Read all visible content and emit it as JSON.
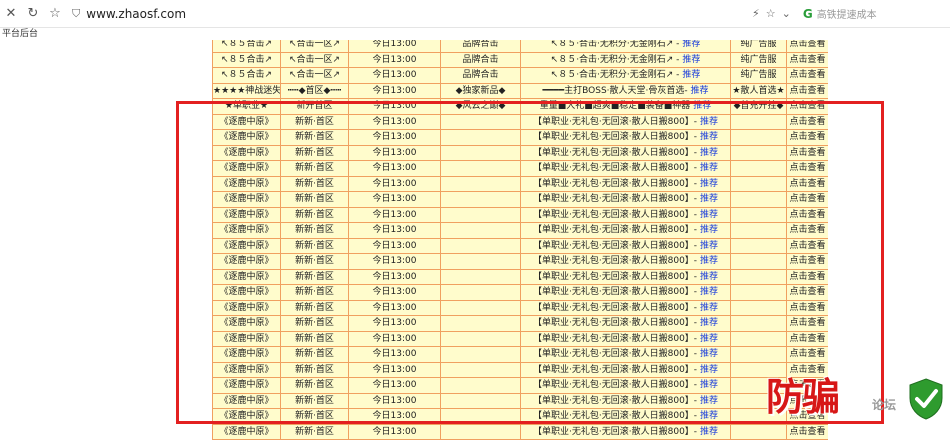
{
  "browser": {
    "url": "www.zhaosf.com",
    "search_placeholder": "高铁提速成本",
    "bookmark": "平台后台",
    "icons": [
      "close-icon",
      "reload-icon",
      "star-icon",
      "shield-icon",
      "lightning-icon",
      "star-outline-icon",
      "chevron-down-icon",
      "search-engine-icon"
    ]
  },
  "colors": {
    "grid_bg": "#fffccc",
    "grid_border": "#f0a060",
    "recommend": "#1a3cdb",
    "highlight_box": "#e32020"
  },
  "rows": [
    {
      "server": "↖８５合击↗",
      "region": "↖合击一区↗",
      "time": "今日13:00",
      "type": "品牌合击",
      "intro": "↖８５·合击·无积分·无金刚石↗ -",
      "rec": "推荐",
      "client": "纯广告服",
      "action": "点击查看"
    },
    {
      "server": "↖８５合击↗",
      "region": "↖合击一区↗",
      "time": "今日13:00",
      "type": "品牌合击",
      "intro": "↖８５·合击·无积分·无金刚石↗ -",
      "rec": "推荐",
      "client": "纯广告服",
      "action": "点击查看"
    },
    {
      "server": "↖８５合击↗",
      "region": "↖合击一区↗",
      "time": "今日13:00",
      "type": "品牌合击",
      "intro": "↖８５·合击·无积分·无金刚石↗ -",
      "rec": "推荐",
      "client": "纯广告服",
      "action": "点击查看"
    },
    {
      "server": "★★★★神战迷失",
      "region": "┅┅◆首区◆┅┅",
      "time": "今日13:00",
      "type": "◆独家新品◆",
      "intro": "━━━━主打BOSS·散人天堂·骨灰首选-",
      "rec": "推荐",
      "client": "★散人首选★",
      "action": "点击查看"
    },
    {
      "server": "★单职业★",
      "region": "新开首区",
      "time": "今日13:00",
      "type": "◆风云之巅◆",
      "intro": "重量■大礼■超爽■稳定■装备■神器",
      "rec": "推荐",
      "client": "◆首充开挂◆",
      "action": "点击查看"
    },
    {
      "server": "《逐鹿中原》",
      "region": "新新·首区",
      "time": "今日13:00",
      "type": "",
      "intro": "【单职业·无礼包·无回滚·散人日搬800】-",
      "rec": "推荐",
      "client": "",
      "action": "点击查看"
    },
    {
      "server": "《逐鹿中原》",
      "region": "新新·首区",
      "time": "今日13:00",
      "type": "",
      "intro": "【单职业·无礼包·无回滚·散人日搬800】-",
      "rec": "推荐",
      "client": "",
      "action": "点击查看"
    },
    {
      "server": "《逐鹿中原》",
      "region": "新新·首区",
      "time": "今日13:00",
      "type": "",
      "intro": "【单职业·无礼包·无回滚·散人日搬800】-",
      "rec": "推荐",
      "client": "",
      "action": "点击查看"
    },
    {
      "server": "《逐鹿中原》",
      "region": "新新·首区",
      "time": "今日13:00",
      "type": "",
      "intro": "【单职业·无礼包·无回滚·散人日搬800】-",
      "rec": "推荐",
      "client": "",
      "action": "点击查看"
    },
    {
      "server": "《逐鹿中原》",
      "region": "新新·首区",
      "time": "今日13:00",
      "type": "",
      "intro": "【单职业·无礼包·无回滚·散人日搬800】-",
      "rec": "推荐",
      "client": "",
      "action": "点击查看"
    },
    {
      "server": "《逐鹿中原》",
      "region": "新新·首区",
      "time": "今日13:00",
      "type": "",
      "intro": "【单职业·无礼包·无回滚·散人日搬800】-",
      "rec": "推荐",
      "client": "",
      "action": "点击查看"
    },
    {
      "server": "《逐鹿中原》",
      "region": "新新·首区",
      "time": "今日13:00",
      "type": "",
      "intro": "【单职业·无礼包·无回滚·散人日搬800】-",
      "rec": "推荐",
      "client": "",
      "action": "点击查看"
    },
    {
      "server": "《逐鹿中原》",
      "region": "新新·首区",
      "time": "今日13:00",
      "type": "",
      "intro": "【单职业·无礼包·无回滚·散人日搬800】-",
      "rec": "推荐",
      "client": "",
      "action": "点击查看"
    },
    {
      "server": "《逐鹿中原》",
      "region": "新新·首区",
      "time": "今日13:00",
      "type": "",
      "intro": "【单职业·无礼包·无回滚·散人日搬800】-",
      "rec": "推荐",
      "client": "",
      "action": "点击查看"
    },
    {
      "server": "《逐鹿中原》",
      "region": "新新·首区",
      "time": "今日13:00",
      "type": "",
      "intro": "【单职业·无礼包·无回滚·散人日搬800】-",
      "rec": "推荐",
      "client": "",
      "action": "点击查看"
    },
    {
      "server": "《逐鹿中原》",
      "region": "新新·首区",
      "time": "今日13:00",
      "type": "",
      "intro": "【单职业·无礼包·无回滚·散人日搬800】-",
      "rec": "推荐",
      "client": "",
      "action": "点击查看"
    },
    {
      "server": "《逐鹿中原》",
      "region": "新新·首区",
      "time": "今日13:00",
      "type": "",
      "intro": "【单职业·无礼包·无回滚·散人日搬800】-",
      "rec": "推荐",
      "client": "",
      "action": "点击查看"
    },
    {
      "server": "《逐鹿中原》",
      "region": "新新·首区",
      "time": "今日13:00",
      "type": "",
      "intro": "【单职业·无礼包·无回滚·散人日搬800】-",
      "rec": "推荐",
      "client": "",
      "action": "点击查看"
    },
    {
      "server": "《逐鹿中原》",
      "region": "新新·首区",
      "time": "今日13:00",
      "type": "",
      "intro": "【单职业·无礼包·无回滚·散人日搬800】-",
      "rec": "推荐",
      "client": "",
      "action": "点击查看"
    },
    {
      "server": "《逐鹿中原》",
      "region": "新新·首区",
      "time": "今日13:00",
      "type": "",
      "intro": "【单职业·无礼包·无回滚·散人日搬800】-",
      "rec": "推荐",
      "client": "",
      "action": "点击查看"
    },
    {
      "server": "《逐鹿中原》",
      "region": "新新·首区",
      "time": "今日13:00",
      "type": "",
      "intro": "【单职业·无礼包·无回滚·散人日搬800】-",
      "rec": "推荐",
      "client": "",
      "action": "点击查看"
    },
    {
      "server": "《逐鹿中原》",
      "region": "新新·首区",
      "time": "今日13:00",
      "type": "",
      "intro": "【单职业·无礼包·无回滚·散人日搬800】-",
      "rec": "推荐",
      "client": "",
      "action": "点击查看"
    },
    {
      "server": "《逐鹿中原》",
      "region": "新新·首区",
      "time": "今日13:00",
      "type": "",
      "intro": "【单职业·无礼包·无回滚·散人日搬800】-",
      "rec": "推荐",
      "client": "",
      "action": "点击查看"
    },
    {
      "server": "《逐鹿中原》",
      "region": "新新·首区",
      "time": "今日13:00",
      "type": "",
      "intro": "【单职业·无礼包·无回滚·散人日搬800】-",
      "rec": "推荐",
      "client": "",
      "action": "点击查看"
    },
    {
      "server": "《逐鹿中原》",
      "region": "新新·首区",
      "time": "今日13:00",
      "type": "",
      "intro": "【单职业·无礼包·无回滚·散人日搬800】-",
      "rec": "推荐",
      "client": "",
      "action": "点击查看"
    },
    {
      "server": "《逐鹿中原》",
      "region": "新新·首区",
      "time": "今日13:00",
      "type": "",
      "intro": "【单职业·无礼包·无回滚·散人日搬800】-",
      "rec": "推荐",
      "client": "",
      "action": "点击查看"
    }
  ],
  "watermark": {
    "main": "防骗",
    "sub": "论坛"
  }
}
